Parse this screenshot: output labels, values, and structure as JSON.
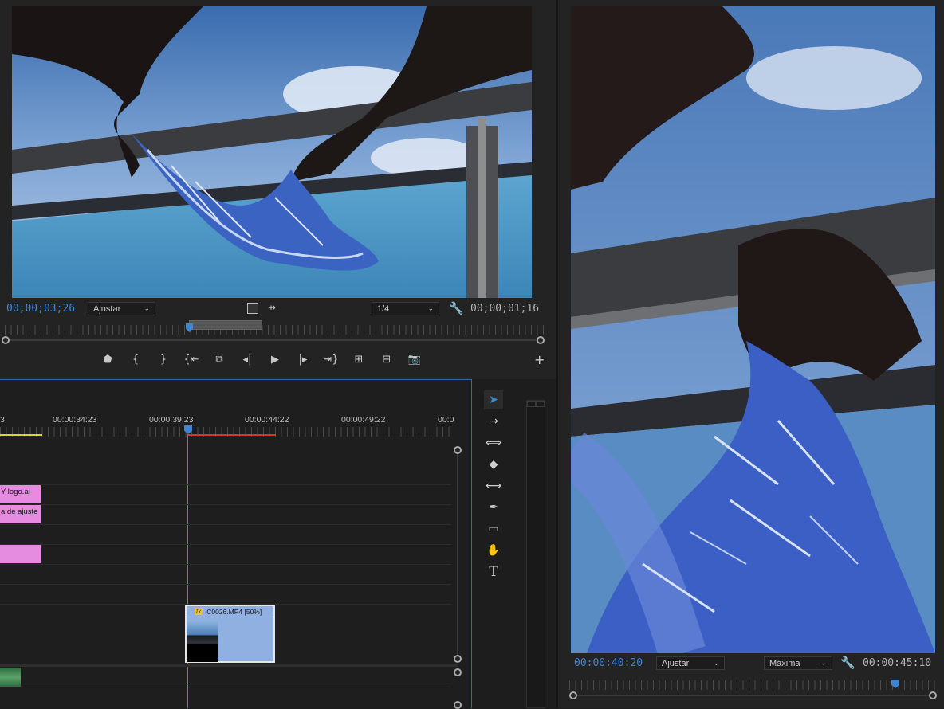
{
  "source_monitor": {
    "timecode_current": "00;00;03;26",
    "timecode_duration": "00;00;01;16",
    "zoom_label": "Ajustar",
    "resolution_label": "1/4"
  },
  "timeline": {
    "ruler_labels": [
      "3",
      "00:00:34:23",
      "00:00:39:23",
      "00:00:44:22",
      "00:00:49:22",
      "00:0"
    ],
    "clips": {
      "logo": "Y logo.ai",
      "adjustment": "a de ajuste",
      "video": "C0026.MP4 [50%]",
      "fx_badge": "fx"
    }
  },
  "program_monitor": {
    "timecode_current": "00:00:40:20",
    "timecode_duration": "00:00:45:10",
    "zoom_label": "Ajustar",
    "quality_label": "Máxima"
  },
  "icons": {
    "tools": [
      "selection-icon",
      "track-select-icon",
      "ripple-edit-icon",
      "razor-icon",
      "slip-icon",
      "pen-icon",
      "rectangle-icon",
      "hand-icon",
      "type-icon"
    ]
  },
  "colors": {
    "accent": "#3d86d6",
    "in_out_red": "#d9362b",
    "work_yellow": "#d8d82b",
    "clip_pink": "#e58be0",
    "clip_video": "#8fb0e0",
    "audio_green": "#5ca36a"
  }
}
